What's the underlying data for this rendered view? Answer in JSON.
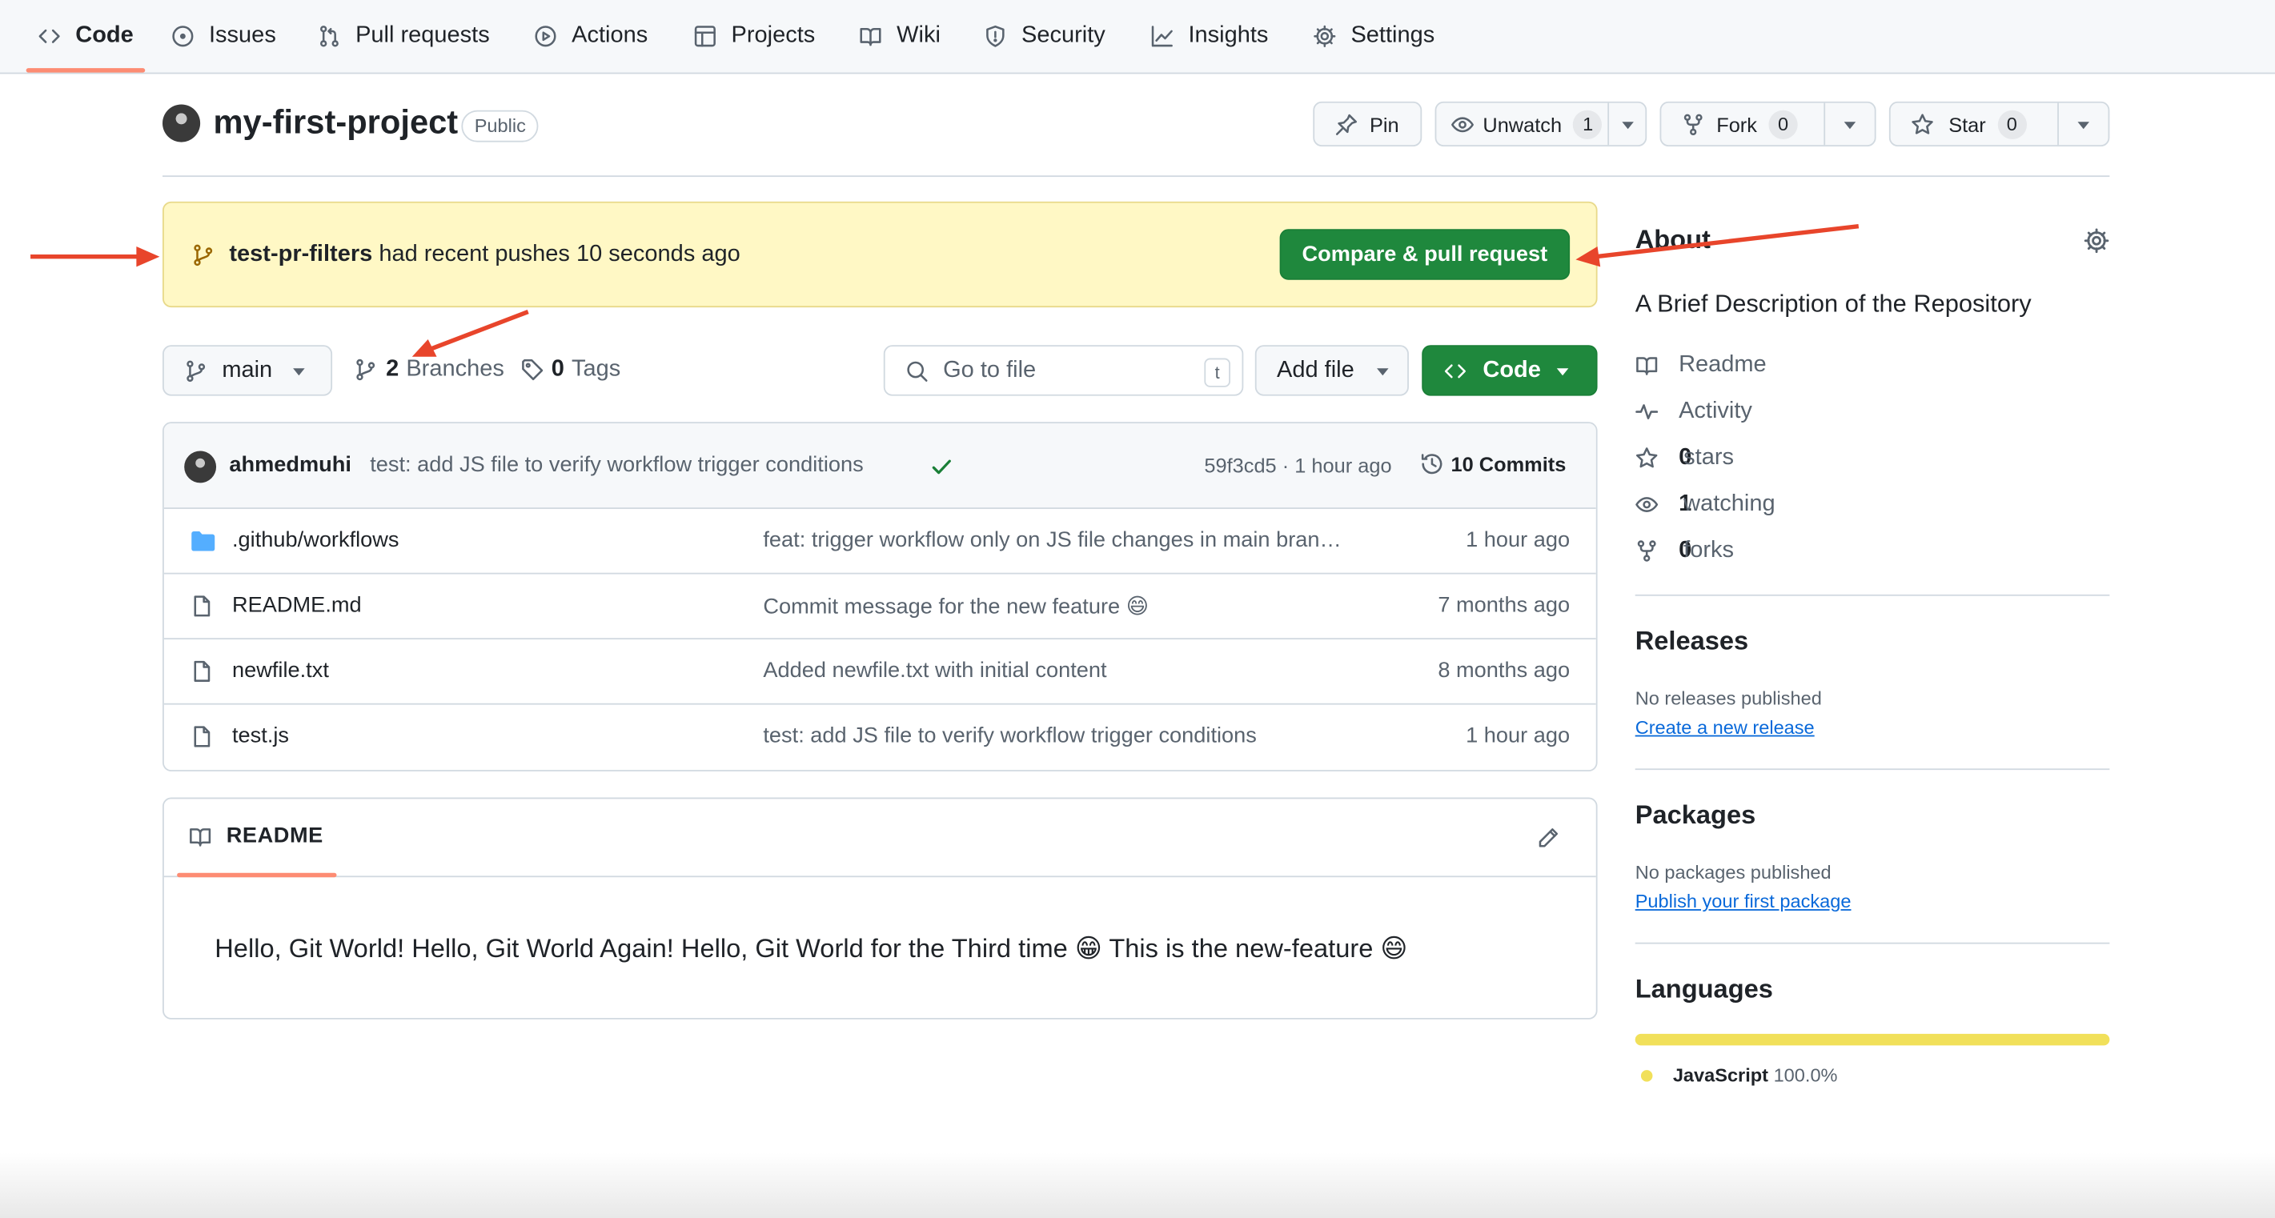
{
  "nav": {
    "tabs": [
      {
        "label": "Code",
        "icon": "code-icon",
        "active": true
      },
      {
        "label": "Issues",
        "icon": "issue-icon"
      },
      {
        "label": "Pull requests",
        "icon": "pull-request-icon"
      },
      {
        "label": "Actions",
        "icon": "play-icon"
      },
      {
        "label": "Projects",
        "icon": "table-icon"
      },
      {
        "label": "Wiki",
        "icon": "book-icon"
      },
      {
        "label": "Security",
        "icon": "shield-icon"
      },
      {
        "label": "Insights",
        "icon": "graph-icon"
      },
      {
        "label": "Settings",
        "icon": "gear-icon"
      }
    ]
  },
  "repo": {
    "name": "my-first-project",
    "visibility": "Public",
    "pin_label": "Pin",
    "watch_label": "Unwatch",
    "watch_count": "1",
    "fork_label": "Fork",
    "fork_count": "0",
    "star_label": "Star",
    "star_count": "0"
  },
  "banner": {
    "branch": "test-pr-filters",
    "text": "had recent pushes 10 seconds ago",
    "button": "Compare & pull request"
  },
  "filenav": {
    "branch": "main",
    "branches_count": "2",
    "branches_label": "Branches",
    "tags_count": "0",
    "tags_label": "Tags",
    "search_placeholder": "Go to file",
    "search_shortcut": "t",
    "add_file": "Add file",
    "code": "Code"
  },
  "commit": {
    "author": "ahmedmuhi",
    "message": "test: add JS file to verify workflow trigger conditions",
    "hash": "59f3cd5",
    "sep": "·",
    "time": "1 hour ago",
    "commits": "10 Commits"
  },
  "files": [
    {
      "name": ".github/workflows",
      "type": "folder",
      "message": "feat: trigger workflow only on JS file changes in main bran…",
      "time": "1 hour ago"
    },
    {
      "name": "README.md",
      "type": "file",
      "message": "Commit message for the new feature 😄",
      "time": "7 months ago"
    },
    {
      "name": "newfile.txt",
      "type": "file",
      "message": "Added newfile.txt with initial content",
      "time": "8 months ago"
    },
    {
      "name": "test.js",
      "type": "file",
      "message": "test: add JS file to verify workflow trigger conditions",
      "time": "1 hour ago"
    }
  ],
  "readme": {
    "tab": "README",
    "body": "Hello, Git World! Hello, Git World Again! Hello, Git World for the Third time 😁 This is the new-feature 😄"
  },
  "about": {
    "title": "About",
    "description": "A Brief Description of the Repository",
    "readme": "Readme",
    "activity": "Activity",
    "stars_count": "0",
    "stars_label": "stars",
    "watching_count": "1",
    "watching_label": "watching",
    "forks_count": "0",
    "forks_label": "forks"
  },
  "releases": {
    "title": "Releases",
    "empty": "No releases published",
    "link": "Create a new release"
  },
  "packages": {
    "title": "Packages",
    "empty": "No packages published",
    "link": "Publish your first package"
  },
  "languages": {
    "title": "Languages",
    "items": [
      {
        "name": "JavaScript",
        "percent": "100.0%",
        "share": 1.0,
        "color": "#f1e05a"
      }
    ]
  },
  "colors": {
    "accent_green": "#1f883d",
    "link": "#0969da",
    "banner_bg": "#fff8c5",
    "annotation_arrow": "#e8452b",
    "tab_underline": "#fd8c73"
  }
}
